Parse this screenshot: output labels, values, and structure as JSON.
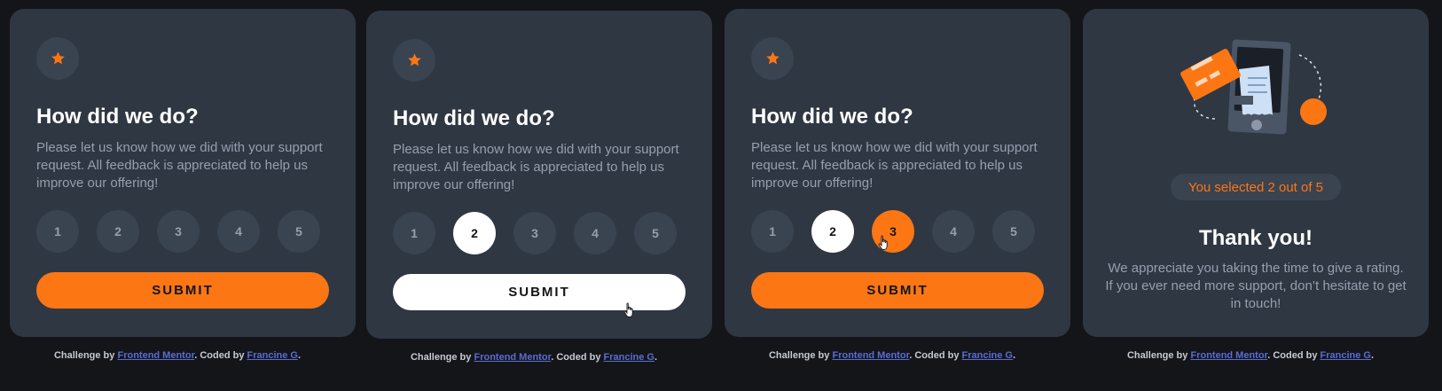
{
  "colors": {
    "background": "#141519",
    "card": "#2f3743",
    "button": "#3a4350",
    "accent": "#fc7614",
    "muted_text": "#969fad",
    "link": "#5c6cd1"
  },
  "icons": {
    "star": "star-icon",
    "cursor": "hand-pointer-icon",
    "illustration": "phone-receipt-card-illustration"
  },
  "rating_panels": [
    {
      "title": "How did we do?",
      "description": "Please let us know how we did with your support request. All feedback is appreciated to help us improve our offering!",
      "ratings": [
        "1",
        "2",
        "3",
        "4",
        "5"
      ],
      "selected": [],
      "hovered": null,
      "submit_label": "SUBMIT",
      "submit_state": "default"
    },
    {
      "title": "How did we do?",
      "description": "Please let us know how we did with your support request. All feedback is appreciated to help us improve our offering!",
      "ratings": [
        "1",
        "2",
        "3",
        "4",
        "5"
      ],
      "selected": [
        "2"
      ],
      "hovered": null,
      "submit_label": "SUBMIT",
      "submit_state": "hover"
    },
    {
      "title": "How did we do?",
      "description": "Please let us know how we did with your support request. All feedback is appreciated to help us improve our offering!",
      "ratings": [
        "1",
        "2",
        "3",
        "4",
        "5"
      ],
      "selected": [
        "2"
      ],
      "hovered": "3",
      "submit_label": "SUBMIT",
      "submit_state": "default"
    }
  ],
  "thank_you_panel": {
    "selection_text": "You selected 2 out of 5",
    "title": "Thank you!",
    "description": "We appreciate you taking the time to give a rating. If you ever need more support, don’t hesitate to get in touch!"
  },
  "attribution": {
    "prefix": "Challenge by ",
    "link1": "Frontend Mentor",
    "middle": ". Coded by ",
    "link2": "Francine G",
    "suffix": "."
  }
}
